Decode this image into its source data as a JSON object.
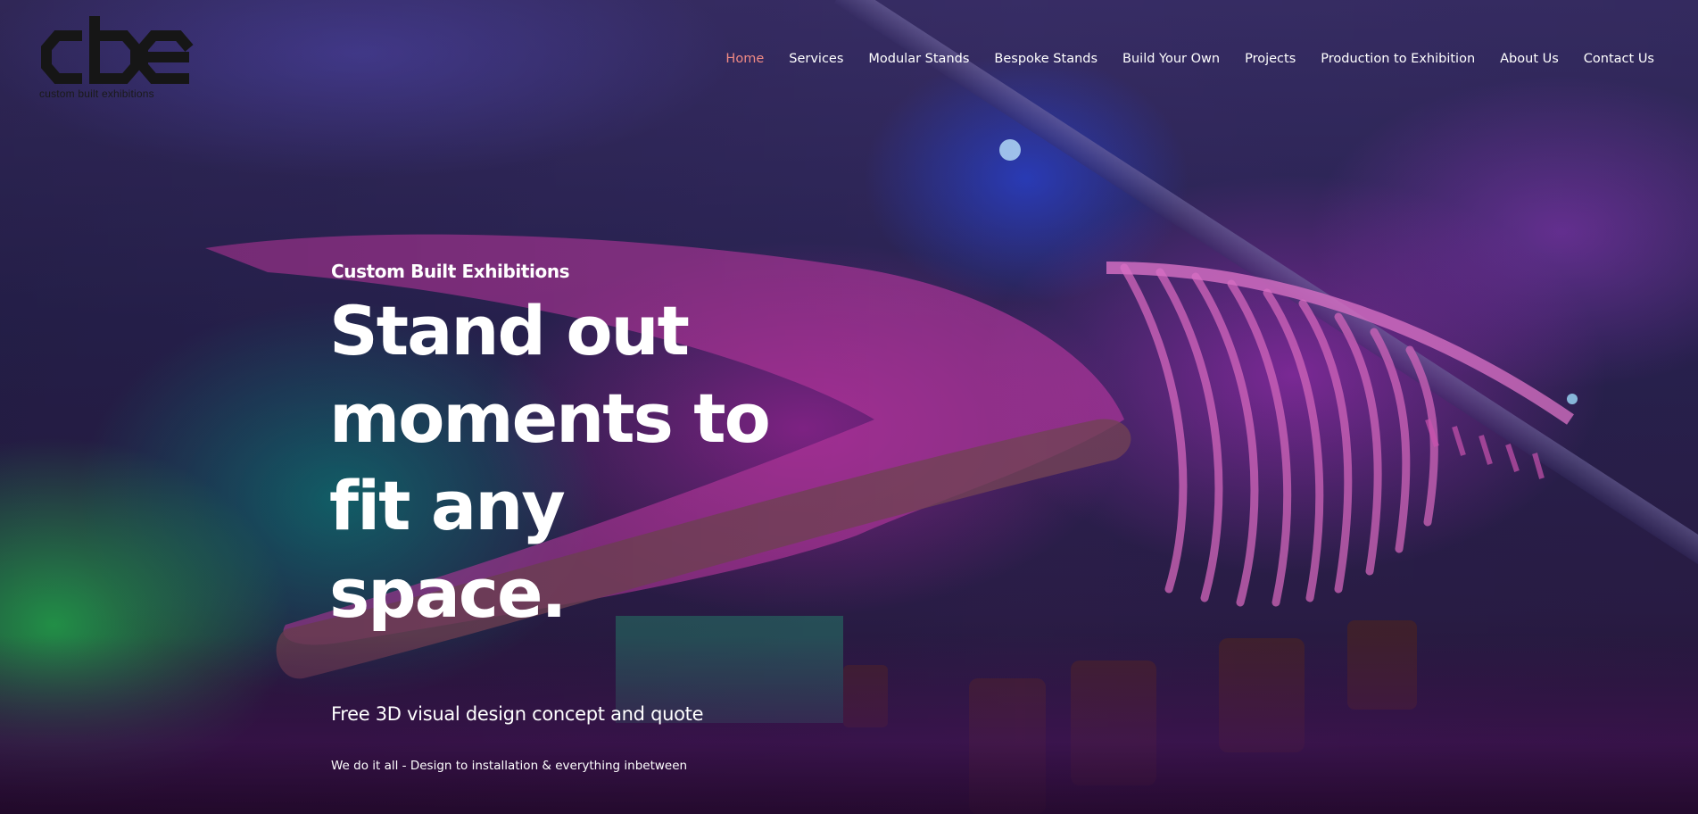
{
  "brand": {
    "logo_tagline": "custom built exhibitions"
  },
  "nav": {
    "items": [
      {
        "label": "Home",
        "active": true
      },
      {
        "label": "Services",
        "active": false
      },
      {
        "label": "Modular Stands",
        "active": false
      },
      {
        "label": "Bespoke Stands",
        "active": false
      },
      {
        "label": "Build Your Own",
        "active": false
      },
      {
        "label": "Projects",
        "active": false
      },
      {
        "label": "Production to Exhibition",
        "active": false
      },
      {
        "label": "About Us",
        "active": false
      },
      {
        "label": "Contact Us",
        "active": false
      }
    ]
  },
  "hero": {
    "kicker": "Custom Built Exhibitions",
    "headline_lines": [
      "Stand out",
      "moments to",
      "fit any",
      "space."
    ],
    "subhead": "Free 3D visual design concept and quote",
    "tagline": "We do it all - Design to installation & everything inbetween"
  },
  "colors": {
    "active_nav": "#f08a84",
    "text": "#ffffff",
    "logo": "#1a1a1a"
  }
}
